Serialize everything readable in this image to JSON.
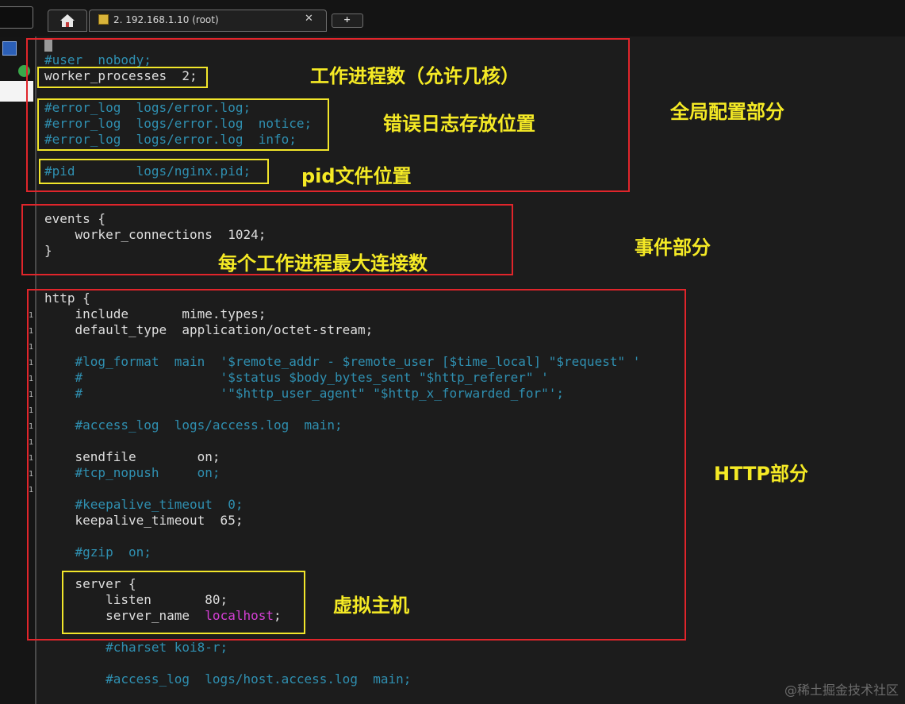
{
  "tabs": {
    "home_icon": "home-icon",
    "session_title": "2. 192.168.1.10 (root)",
    "close_label": "✕",
    "new_tab_label": "+"
  },
  "code_lines": [
    "#user  nobody;",
    "worker_processes  2;",
    "#error_log  logs/error.log;",
    "#error_log  logs/error.log  notice;",
    "#error_log  logs/error.log  info;",
    "#pid        logs/nginx.pid;",
    "events {",
    "    worker_connections  1024;",
    "}",
    "http {",
    "    include       mime.types;",
    "    default_type  application/octet-stream;",
    "    #log_format  main  '$remote_addr - $remote_user [$time_local] \"$request\" '",
    "    #                  '$status $body_bytes_sent \"$http_referer\" '",
    "    #                  '\"$http_user_agent\" \"$http_x_forwarded_for\"';",
    "    #access_log  logs/access.log  main;",
    "    sendfile        on;",
    "    #tcp_nopush     on;",
    "    #keepalive_timeout  0;",
    "    keepalive_timeout  65;",
    "    #gzip  on;",
    "    server {",
    "        listen       80;",
    "        server_name  ",
    "localhost",
    ";",
    "        #charset koi8-r;",
    "        #access_log  logs/host.access.log  main;"
  ],
  "annotations": {
    "worker_processes": "工作进程数（允许几核）",
    "error_log": "错误日志存放位置",
    "pid": "pid文件位置",
    "global": "全局配置部分",
    "events": "事件部分",
    "worker_connections": "每个工作进程最大连接数",
    "http": "HTTP部分",
    "server": "虚拟主机"
  },
  "gutter_marker": "1",
  "watermark": "@稀土掘金技术社区",
  "colors": {
    "comment": "#2f8fb0",
    "string_value": "#d43fd4",
    "annotation": "#f5ea25",
    "section_box": "#e0252b",
    "highlight_box": "#f2e62a"
  }
}
